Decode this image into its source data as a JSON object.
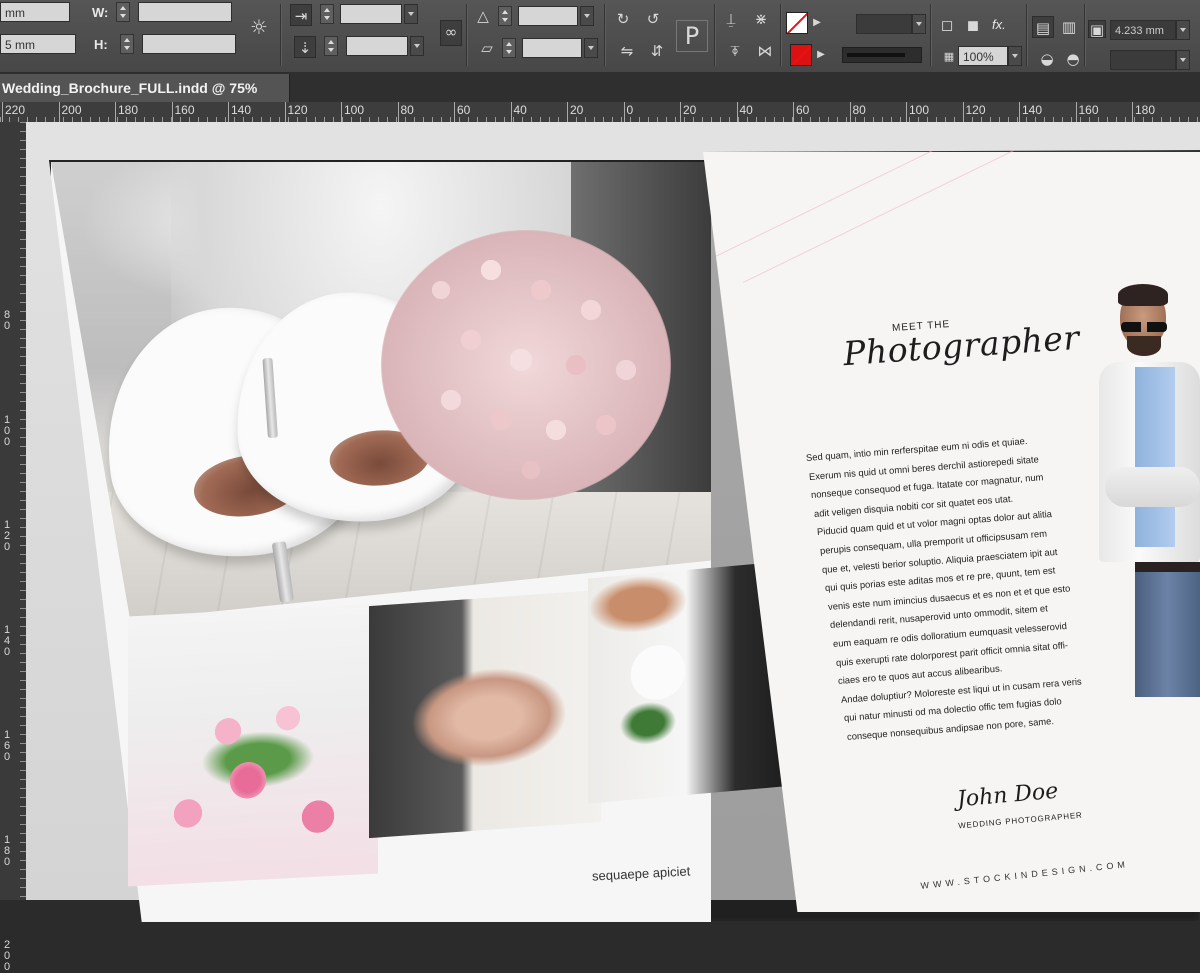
{
  "control_panel": {
    "x_field": "mm",
    "y_field": "5 mm",
    "w_label": "W:",
    "h_label": "H:",
    "w_field": "",
    "h_field": "",
    "stroke_weight": "4.233 mm",
    "opacity": "100%",
    "fx_label": "fx."
  },
  "document": {
    "tab_title": "Wedding_Brochure_FULL.indd @ 75%"
  },
  "rulers": {
    "horizontal": [
      "220",
      "200",
      "180",
      "160",
      "140",
      "120",
      "100",
      "80",
      "60",
      "40",
      "20",
      "0",
      "20",
      "40",
      "60",
      "80",
      "100",
      "120",
      "140",
      "160",
      "180"
    ],
    "vertical": [
      "80",
      "100",
      "120",
      "140",
      "160",
      "180",
      "200"
    ]
  },
  "spread": {
    "left_footer_text": "sequaepe apiciet",
    "right_page": {
      "kicker": "MEET THE",
      "heading": "Photographer",
      "bio_lines": [
        "Sed quam, intio min rerferspitae eum ni odis et quiae.",
        "Exerum nis quid ut omni beres derchil astiorepedi sitate",
        "nonseque consequod et fuga. Itatate cor magnatur, num",
        "adit veligen disquia nobiti cor sit quatet eos utat.",
        "Piducid quam quid et ut volor magni optas dolor aut alitia",
        "perupis consequam, ulla premporit ut officipsusam rem",
        "que et, velesti berior soluptio. Aliquia praesciatem ipit aut",
        "qui quis porias este aditas mos et re pre, quunt, tem est",
        "venis este num imincius dusaecus et es non et et que esto",
        "delendandi rerit, nusaperovid unto ommodit, sitem et",
        "eum eaquam re odis dolloratium eumquasit velesserovid",
        "quis exerupti rate dolorporest parit officit omnia sitat offi-",
        "ciaes ero te quos aut accus alibearibus.",
        "Andae doluptiur? Moloreste est liqui ut in cusam rera veris",
        "qui natur minusti od ma dolectio offic tem fugias dolo",
        "conseque nonsequibus andipsae non pore, same."
      ],
      "signature": "John Doe",
      "signature_title": "WEDDING PHOTOGRAPHER",
      "website": "WWW.STOCKINDESIGN.COM"
    }
  },
  "icons": {
    "constrain": "chain-link-icon",
    "reference_point": "reference-point-icon",
    "rotate": "rotate-icon",
    "shear": "shear-icon",
    "flip": "flip-icon",
    "paragraph": "paragraph-icon",
    "fill": "fill-swatch-icon",
    "stroke": "stroke-swatch-icon"
  },
  "colors": {
    "ui_panel": "#4f4f4f",
    "ui_dark": "#2f2f2f",
    "none_swatch_slash": "#e11111",
    "guide_pink": "#f0b7c7"
  }
}
